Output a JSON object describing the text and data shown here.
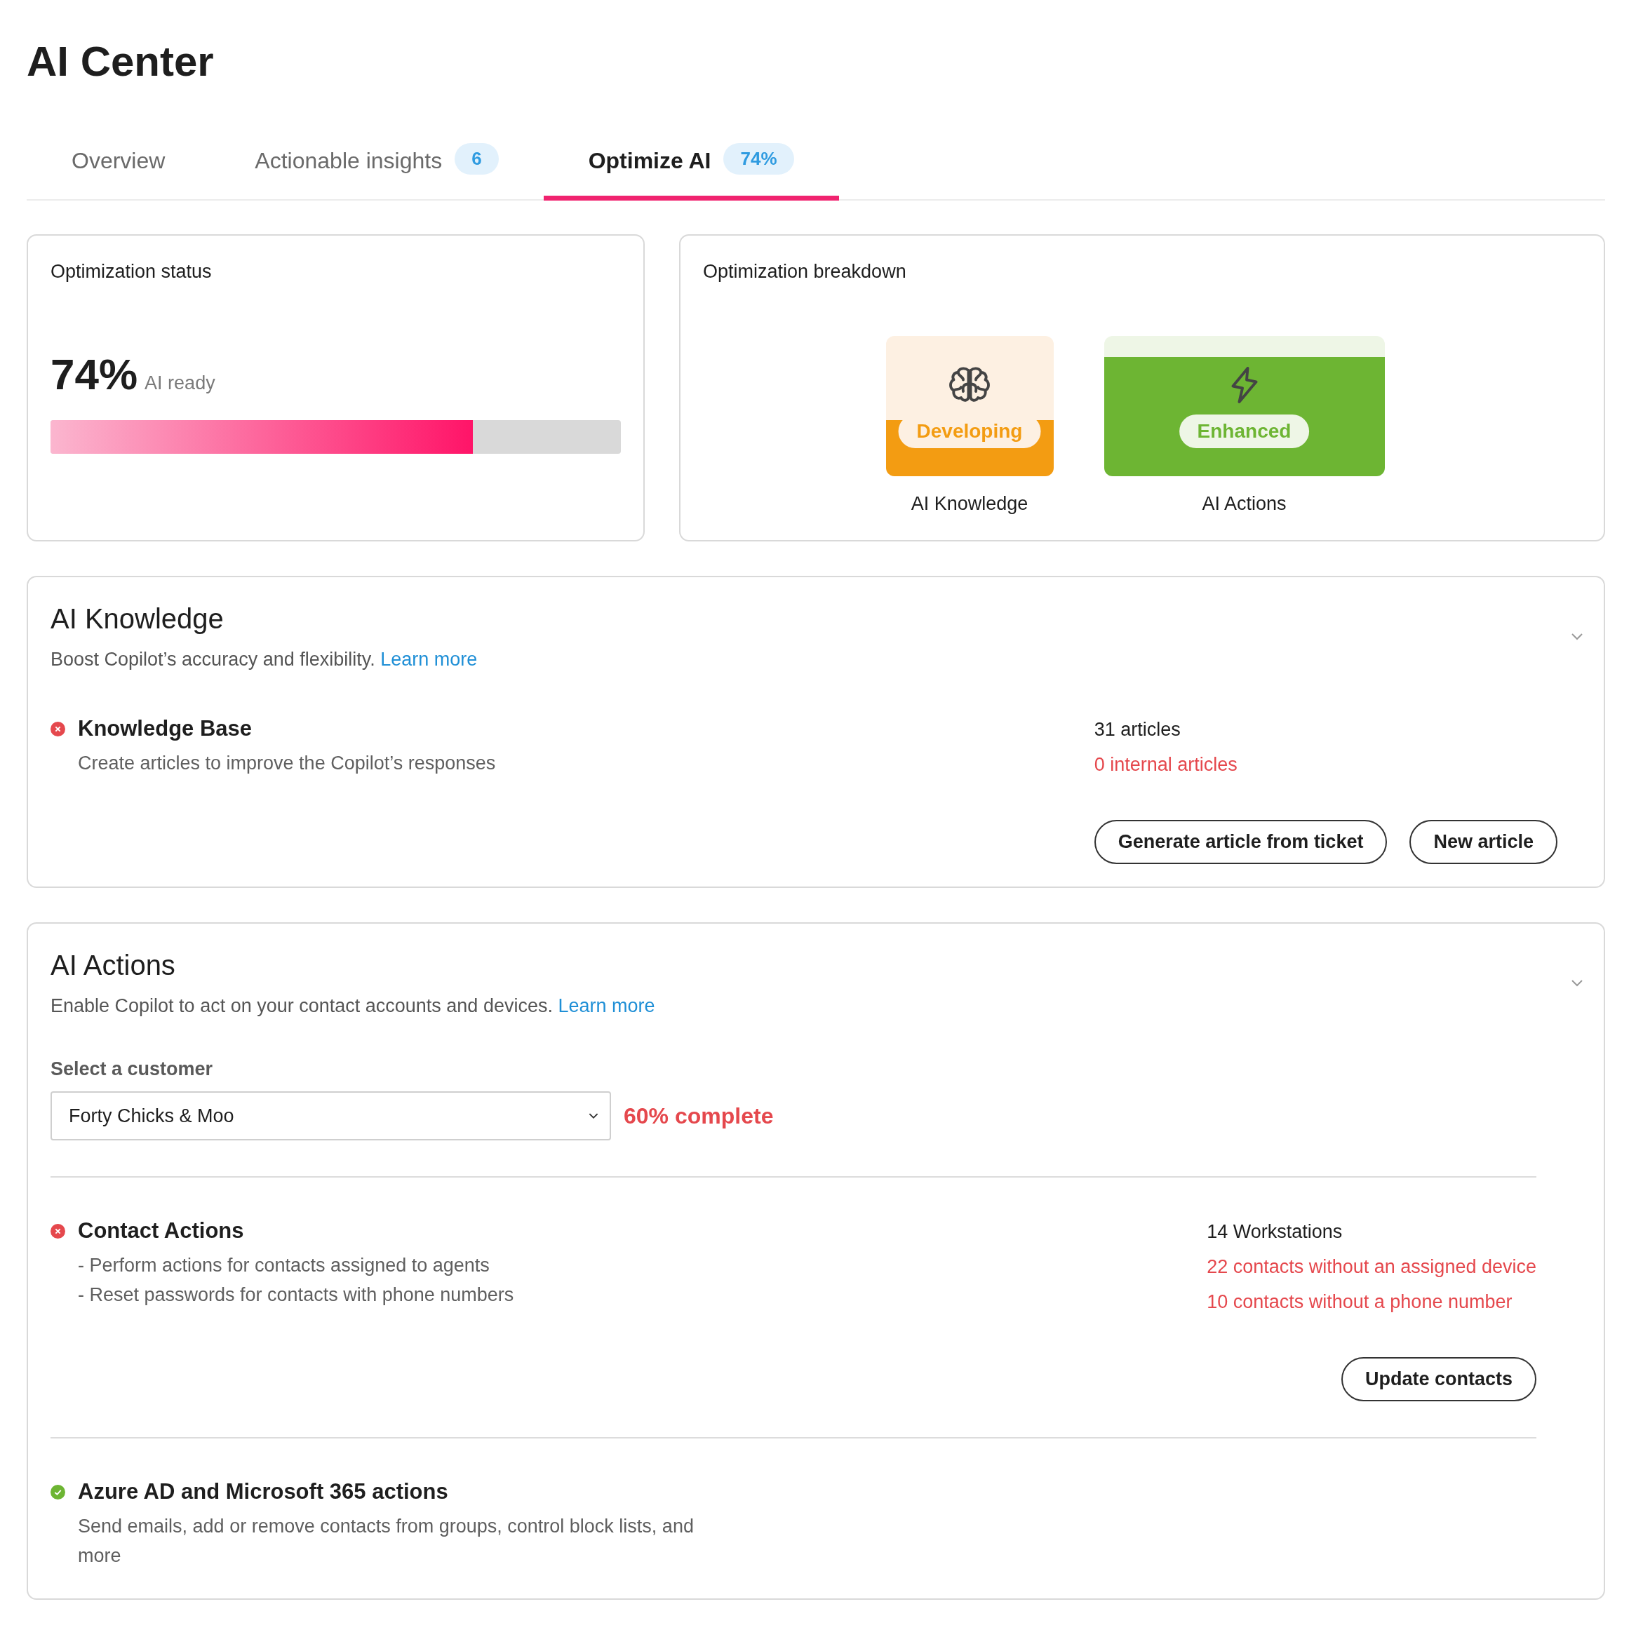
{
  "page_title": "AI Center",
  "tabs": [
    {
      "label": "Overview",
      "selected": false
    },
    {
      "label": "Actionable insights",
      "badge": "6",
      "selected": false
    },
    {
      "label": "Optimize AI",
      "badge": "74%",
      "selected": true
    }
  ],
  "status_card": {
    "title": "Optimization status",
    "value": "74%",
    "caption": "AI ready",
    "level": 0.74
  },
  "breakdown_card": {
    "title": "Optimization breakdown",
    "tiles": [
      {
        "kind": "knowledge",
        "badge": "Developing",
        "label": "AI Knowledge"
      },
      {
        "kind": "actions",
        "badge": "Enhanced",
        "label": "AI Actions"
      }
    ]
  },
  "sections": [
    {
      "kind": "knowledge",
      "title": "AI Knowledge",
      "description": "Boost Copilot’s accuracy and flexibility.",
      "link": "Learn more",
      "items": [
        {
          "title": "Knowledge Base",
          "complete": false,
          "lines": [
            "Create articles to improve the Copilot’s responses"
          ],
          "stats": [
            {
              "text": "31 articles",
              "alert": false
            },
            {
              "text": "0 internal articles",
              "alert": true
            }
          ],
          "buttons": [
            "Generate article from ticket",
            "New article"
          ]
        }
      ]
    },
    {
      "kind": "actions",
      "title": "AI Actions",
      "description": "Enable Copilot to act on your contact accounts and devices.",
      "link": "Learn more",
      "selector": {
        "label": "Select a customer",
        "value": "Forty Chicks & Moo",
        "progress": "60% complete"
      },
      "items": [
        {
          "title": "Contact Actions",
          "complete": false,
          "lines": [
            "- Perform actions for contacts assigned to agents",
            "- Reset passwords for contacts with phone numbers"
          ],
          "stats": [
            {
              "text": "14 Workstations",
              "alert": false
            },
            {
              "text": "22 contacts without an assigned device",
              "alert": true
            },
            {
              "text": "10 contacts without a phone number",
              "alert": true
            }
          ],
          "buttons": [
            "Update contacts"
          ]
        },
        {
          "title": "Azure AD and Microsoft 365 actions",
          "complete": true,
          "lines": [
            "Send emails, add or remove contacts from groups, control block lists, and more"
          ]
        }
      ]
    }
  ]
}
